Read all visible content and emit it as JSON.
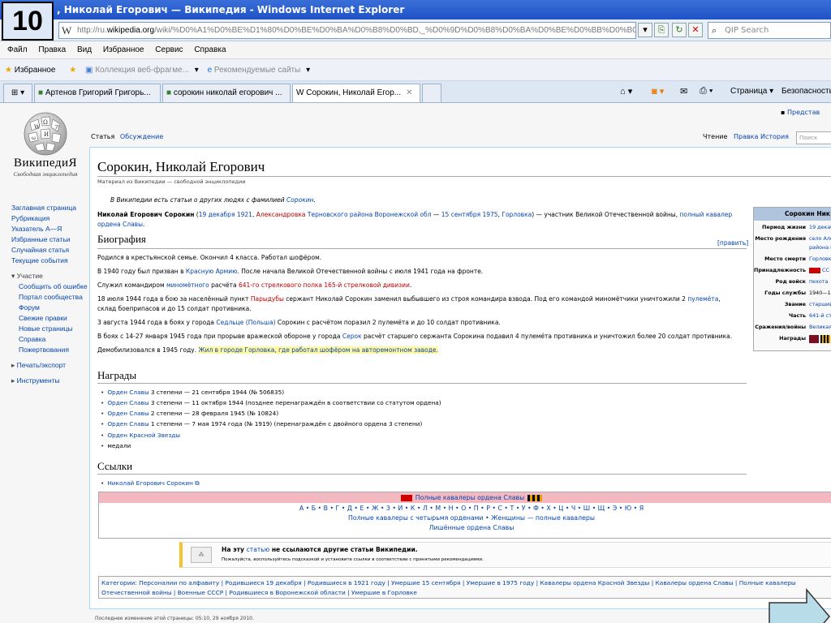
{
  "slide_number": "10",
  "window": {
    "title": ", Николай Егорович — Википедия - Windows Internet Explorer"
  },
  "address": {
    "logo": "W",
    "prefix": "http://ru.",
    "domain": "wikipedia.org",
    "rest": "/wiki/%D0%A1%D0%BE%D1%80%D0%BE%D0%BA%D0%B8%D0%BD,_%D0%9D%D0%B8%D0%BA%D0%BE%D0%BB%D0%B0%D0%B9"
  },
  "qip_search": {
    "placeholder": "QIP Search"
  },
  "menu": [
    "Файл",
    "Правка",
    "Вид",
    "Избранное",
    "Сервис",
    "Справка"
  ],
  "favorites": {
    "label": "Избранное",
    "gallery": "Коллекция веб-фрагме...",
    "suggested": "Рекомендуемые сайты"
  },
  "tabs": [
    {
      "label": "Артенов Григорий Григорь..."
    },
    {
      "label": "сорокин николай егорович ..."
    },
    {
      "label": "Сорокин, Николай Егор..."
    }
  ],
  "cmdbar": {
    "page": "Страница",
    "security": "Безопасность"
  },
  "wiki": {
    "logo_name": "ВикипедиЯ",
    "logo_sub": "Свободная энциклопедия",
    "top_link": "Представ",
    "nav": {
      "main": [
        "Заглавная страница",
        "Рубрикация",
        "Указатель А—Я",
        "Избранные статьи",
        "Случайная статья",
        "Текущие события"
      ],
      "participation_title": "Участие",
      "participation": [
        "Сообщить об ошибке",
        "Портал сообщества",
        "Форум",
        "Свежие правки",
        "Новые страницы",
        "Справка",
        "Пожертвования"
      ],
      "print": "Печать/экспорт",
      "tools": "Инструменты"
    },
    "tabs": {
      "article": "Статья",
      "discussion": "Обсуждение",
      "read": "Чтение",
      "edit": "Правка",
      "history": "История",
      "search": "Поиск"
    },
    "title": "Сорокин, Николай Егорович",
    "from": "Материал из Википедии — свободной энциклопедии",
    "hatnote": {
      "pre": "В Википедии есть статьи о других людях с фамилией ",
      "link": "Сорокин",
      "post": "."
    },
    "lead": {
      "name": "Николай Егорович Сорокин",
      "p1": " (",
      "born": "19 декабря 1921",
      "c1": ", ",
      "village": "Александровка",
      "c2": " ",
      "district": "Терновского района Воронежской обл",
      "dash": " — ",
      "died": "15 сентября 1975",
      "c3": ", ",
      "city": "Горловка",
      "p2": ") — участник Великой Отечественной войны, ",
      "award": "полный кавалер ордена Славы",
      "end": "."
    },
    "bio_heading": "Биография",
    "edit_link": "[править]",
    "bio": {
      "p1": "Родился в крестьянской семье. Окончил 4 класса. Работал шофёром.",
      "p2a": "В 1940 году был призван в ",
      "p2link": "Красную Армию",
      "p2b": ". После начала Великой Отечественной войны с июля 1941 года на фронте.",
      "p3a": "Служил командиром ",
      "p3link1": "миномётного",
      "p3b": " расчёта ",
      "p3link2": "641-го стрелкового полка 165-й стрелковой дивизии",
      "p3c": ".",
      "p4a": "18 июля 1944 года в бою за населённый пункт ",
      "p4link1": "Парыдубы",
      "p4b": " сержант Николай Сорокин заменил выбывшего из строя командира взвода. Под его командой миномётчики уничтожили 2 ",
      "p4link2": "пулемёта",
      "p4c": ", склад боеприпасов и до 15 солдат противника.",
      "p5a": "3 августа 1944 года в боях у города ",
      "p5link": "Седльце (Польша)",
      "p5b": " Сорокин с расчётом поразил 2 пулемёта и до 10 солдат противника.",
      "p6a": "В боях с 14-27 января 1945 года при прорыве вражеской обороне у города ",
      "p6link": "Серок",
      "p6b": " расчёт старшего сержанта Сорокина подавил 4 пулемёта противника и уничтожил более 20 солдат противника.",
      "p7a": "Демобилизовался в 1945 году. ",
      "p7hl": "Жил в городе Горловка, где работал шофёром на авторемонтном заводе."
    },
    "awards_heading": "Награды",
    "awards": [
      {
        "link": "Орден Славы",
        "text": " 3 степени — 21 сентября 1944 (№ 506835)"
      },
      {
        "link": "Орден Славы",
        "text": " 3 степени — 11 октября 1944 (позднее перенаграждён в соответствии со статутом ордена)"
      },
      {
        "link": "Орден Славы",
        "text": " 2 степени — 28 февраля 1945 (№ 10824)"
      },
      {
        "link": "Орден Славы",
        "text": " 1 степени — 7 мая 1974 года (№ 1919) (перенаграждён с двойного ордена 3 степени)"
      },
      {
        "link": "Орден Красной Звезды",
        "text": ""
      },
      {
        "link": "",
        "text": "медали"
      }
    ],
    "links_heading": "Ссылки",
    "links": [
      {
        "link": "Николай Егорович Сорокин",
        "text": ""
      }
    ],
    "navbox": {
      "title": "Полные кавалеры ордена Славы",
      "letters": "А • Б • В • Г • Д • Е • Ж • З • И • К • Л • М • Н • О • П • Р • С • Т • У • Ф • Х • Ц • Ч • Ш • Щ • Э • Ю • Я",
      "row2": "Полные кавалеры с четырьмя орденами • Женщины — полные кавалеры",
      "row3": "Лишённые ордена Славы"
    },
    "orphan": {
      "a": "На эту ",
      "link": "статью",
      "b": " не ссылаются другие статьи Википедии.",
      "c": "Пожалуйста, воспользуйтесь подсказкой и установите ссылки в соответствии с принятыми рекомендациями."
    },
    "categories": {
      "line1": "Категории: Персоналии по алфавиту | Родившиеся 19 декабря | Родившиеся в 1921 году | Умершие 15 сентября | Умершие в 1975 году | Кавалеры ордена Красной Звезды | Кавалеры ордена Славы | Полные кавалеры",
      "line2": "Отечественной войны | Военные СССР | Родившиеся в Воронежской области | Умершие в Горловке"
    },
    "footer": "Последнее изменение этой страницы: 05:10, 29 ноября 2010.",
    "infobox": {
      "title": "Сорокин Ник",
      "rows": [
        {
          "k": "Период жизни",
          "v": "19 декаб"
        },
        {
          "k": "Место рождения",
          "v": "село Але"
        },
        {
          "k": "",
          "v": "района Во"
        },
        {
          "k": "Место смерти",
          "v": "Горловка"
        },
        {
          "k": "Принадлежность",
          "v": "СС"
        },
        {
          "k": "Род войск",
          "v": "пехота"
        },
        {
          "k": "Годы службы",
          "v": "1940—19"
        },
        {
          "k": "Звание",
          "v": "старший"
        },
        {
          "k": "Часть",
          "v": "641-й ст"
        },
        {
          "k": "Сражения/войны",
          "v": "Великая"
        },
        {
          "k": "Награды",
          "v": ""
        }
      ]
    }
  },
  "colors": {
    "link": "#0645ad",
    "redlink": "#ba0000",
    "highlight": "#fff8a0",
    "titlebar": "#2a5fd0",
    "arrow": "#b8dce8"
  }
}
